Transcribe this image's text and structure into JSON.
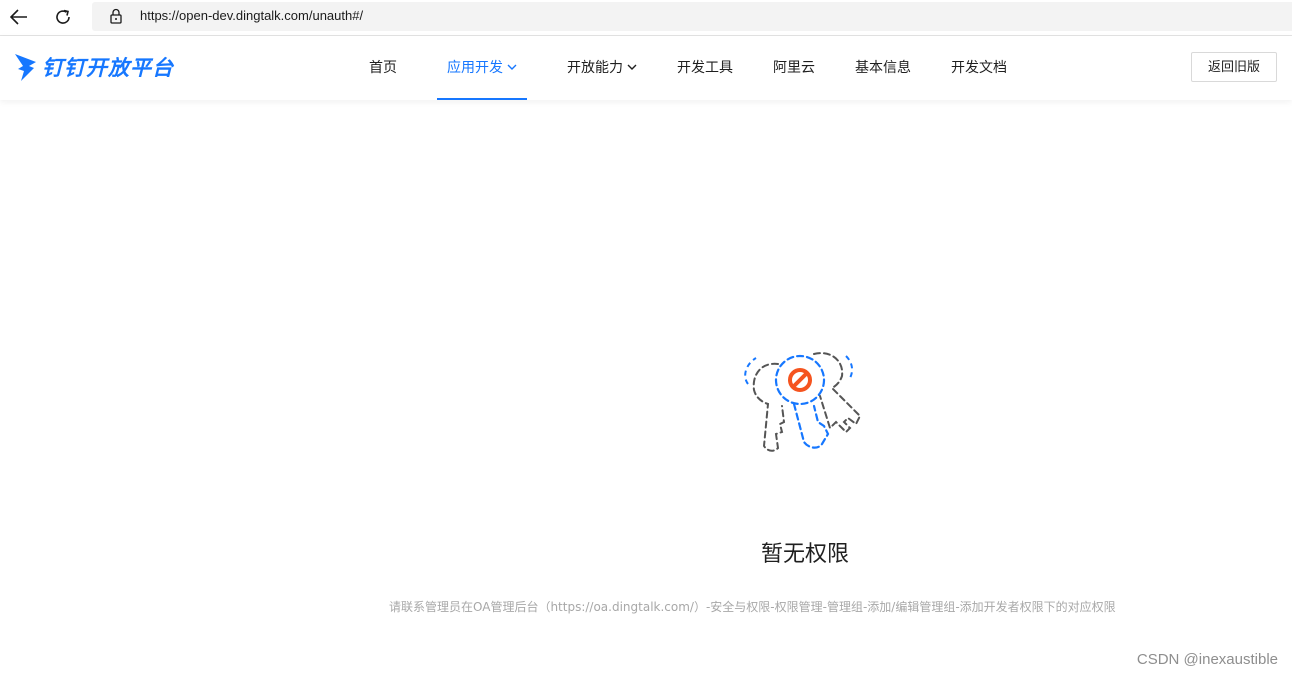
{
  "browser": {
    "url": "https://open-dev.dingtalk.com/unauth#/"
  },
  "header": {
    "logo_text": "钉钉开放平台",
    "nav": [
      {
        "label": "首页"
      },
      {
        "label": "应用开发",
        "active": true,
        "has_dropdown": true
      },
      {
        "label": "开放能力",
        "has_dropdown": true
      },
      {
        "label": "开发工具"
      },
      {
        "label": "阿里云"
      },
      {
        "label": "基本信息"
      },
      {
        "label": "开发文档"
      }
    ],
    "old_version_label": "返回旧版"
  },
  "empty_state": {
    "title": "暂无权限",
    "description": "请联系管理员在OA管理后台（https://oa.dingtalk.com/）-安全与权限-权限管理-管理组-添加/编辑管理组-添加开发者权限下的对应权限"
  },
  "watermark": "CSDN @inexaustible",
  "colors": {
    "accent": "#1677ff",
    "forbidden": "#f5541f",
    "key_outline": "#555555"
  },
  "icons": {
    "back": "arrow-left-icon",
    "reload": "reload-icon",
    "lock": "lock-icon",
    "logo": "dingtalk-logo-icon",
    "chevron": "chevron-down-icon",
    "illustration": "keys-forbidden-illustration"
  }
}
